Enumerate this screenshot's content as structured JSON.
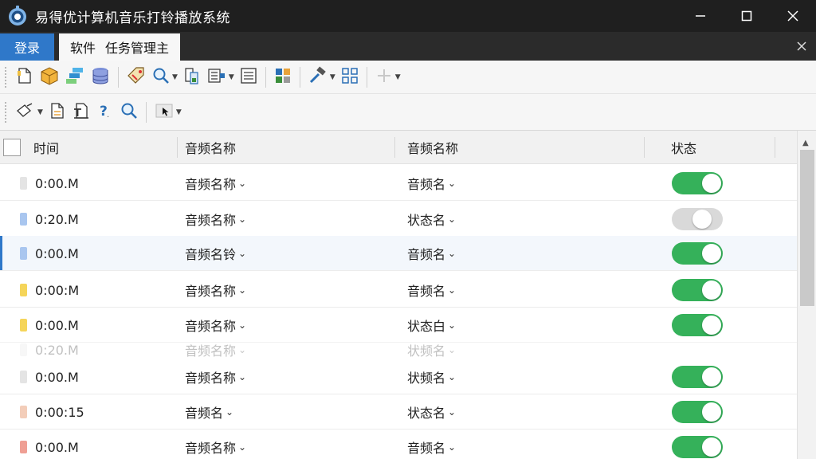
{
  "window": {
    "title": "易得优计算机音乐打铃播放系统",
    "controls": [
      "—",
      "☐",
      "✕"
    ]
  },
  "tabs": {
    "home": "登录",
    "active": [
      "软件",
      "任务管理主"
    ],
    "close": "×"
  },
  "table": {
    "headers": [
      "时间",
      "音频名称",
      "音频名称",
      "状态"
    ],
    "rows": [
      {
        "time": "0:00.M",
        "name": "音频名称",
        "col3": "音频名",
        "icon_color": "#e4e4e4",
        "on": true
      },
      {
        "time": "0:20.M",
        "name": "音频名称",
        "col3": "状态名",
        "icon_color": "#a9c6ef",
        "on": false
      },
      {
        "time": "0:00.M",
        "name": "音频名铃",
        "col3": "音频名",
        "icon_color": "#a9c6ef",
        "on": true,
        "selected": true
      },
      {
        "time": "0:00:M",
        "name": "音频名称",
        "col3": "音频名",
        "icon_color": "#f5d55a",
        "on": true
      },
      {
        "time": "0:00.M",
        "name": "音频名称",
        "col3": "状态白",
        "icon_color": "#f5d55a",
        "on": true
      },
      {
        "time": "0:20.M",
        "name": "音频名称",
        "col3": "状频名",
        "icon_color": "#e4e4e4",
        "on": null,
        "dim": true
      },
      {
        "time": "0:00.M",
        "name": "音频名称",
        "col3": "状频名",
        "icon_color": "#e4e4e4",
        "on": true
      },
      {
        "time": "0:00:15",
        "name": "音频名",
        "col3": "状态名",
        "icon_color": "#f3cdb9",
        "on": true
      },
      {
        "time": "0:00.M",
        "name": "音频名称",
        "col3": "音频名",
        "icon_color": "#ef9f94",
        "on": true
      }
    ]
  },
  "colors": {
    "titlebar": "#1f1f1f",
    "tab_accent": "#2f78c9",
    "toggle_on": "#35b15a",
    "toggle_off": "#d9d9d9"
  }
}
